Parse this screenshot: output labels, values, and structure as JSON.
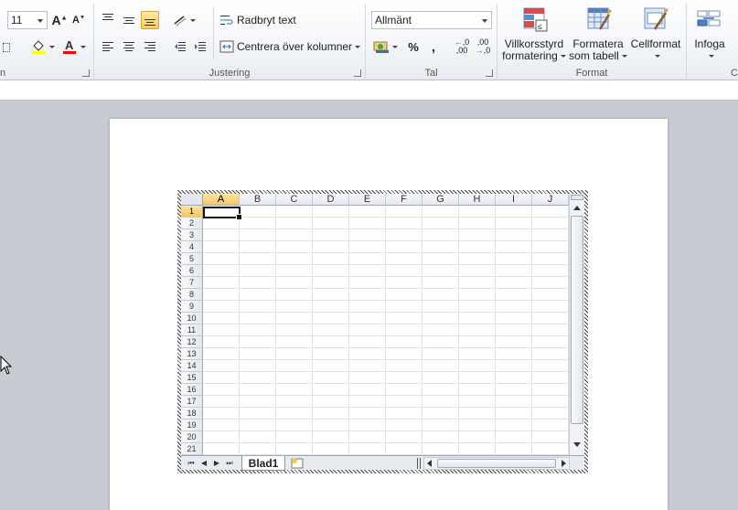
{
  "ribbon": {
    "font_size": "11",
    "wrap_text": "Radbryt text",
    "merge_center": "Centrera över kolumner",
    "number_format": "Allmänt",
    "percent": "%",
    "comma": ",",
    "dec_inc": "←,0\n,00",
    "dec_dec": ",00\n→,0",
    "cond_format_1": "Villkorsstyrd",
    "cond_format_2": "formatering",
    "format_table_1": "Formatera",
    "format_table_2": "som tabell",
    "cell_styles": "Cellformat",
    "insert": "Infoga",
    "groups": {
      "font_tail": "n",
      "alignment": "Justering",
      "number": "Tal",
      "styles": "Format",
      "cells_tail": "C"
    },
    "colors": {
      "highlight": "#ffff00",
      "font_color": "#ff0000",
      "active_align": "#fbcf5d"
    }
  },
  "sheet": {
    "columns": [
      "A",
      "B",
      "C",
      "D",
      "E",
      "F",
      "G",
      "H",
      "I",
      "J"
    ],
    "rows": [
      "1",
      "2",
      "3",
      "4",
      "5",
      "6",
      "7",
      "8",
      "9",
      "10",
      "11",
      "12",
      "13",
      "14",
      "15",
      "16",
      "17",
      "18",
      "19",
      "20",
      "21"
    ],
    "selected_cell": "A1",
    "tab_name": "Blad1",
    "nav": [
      "⏮",
      "◀",
      "▶",
      "⏭"
    ]
  }
}
